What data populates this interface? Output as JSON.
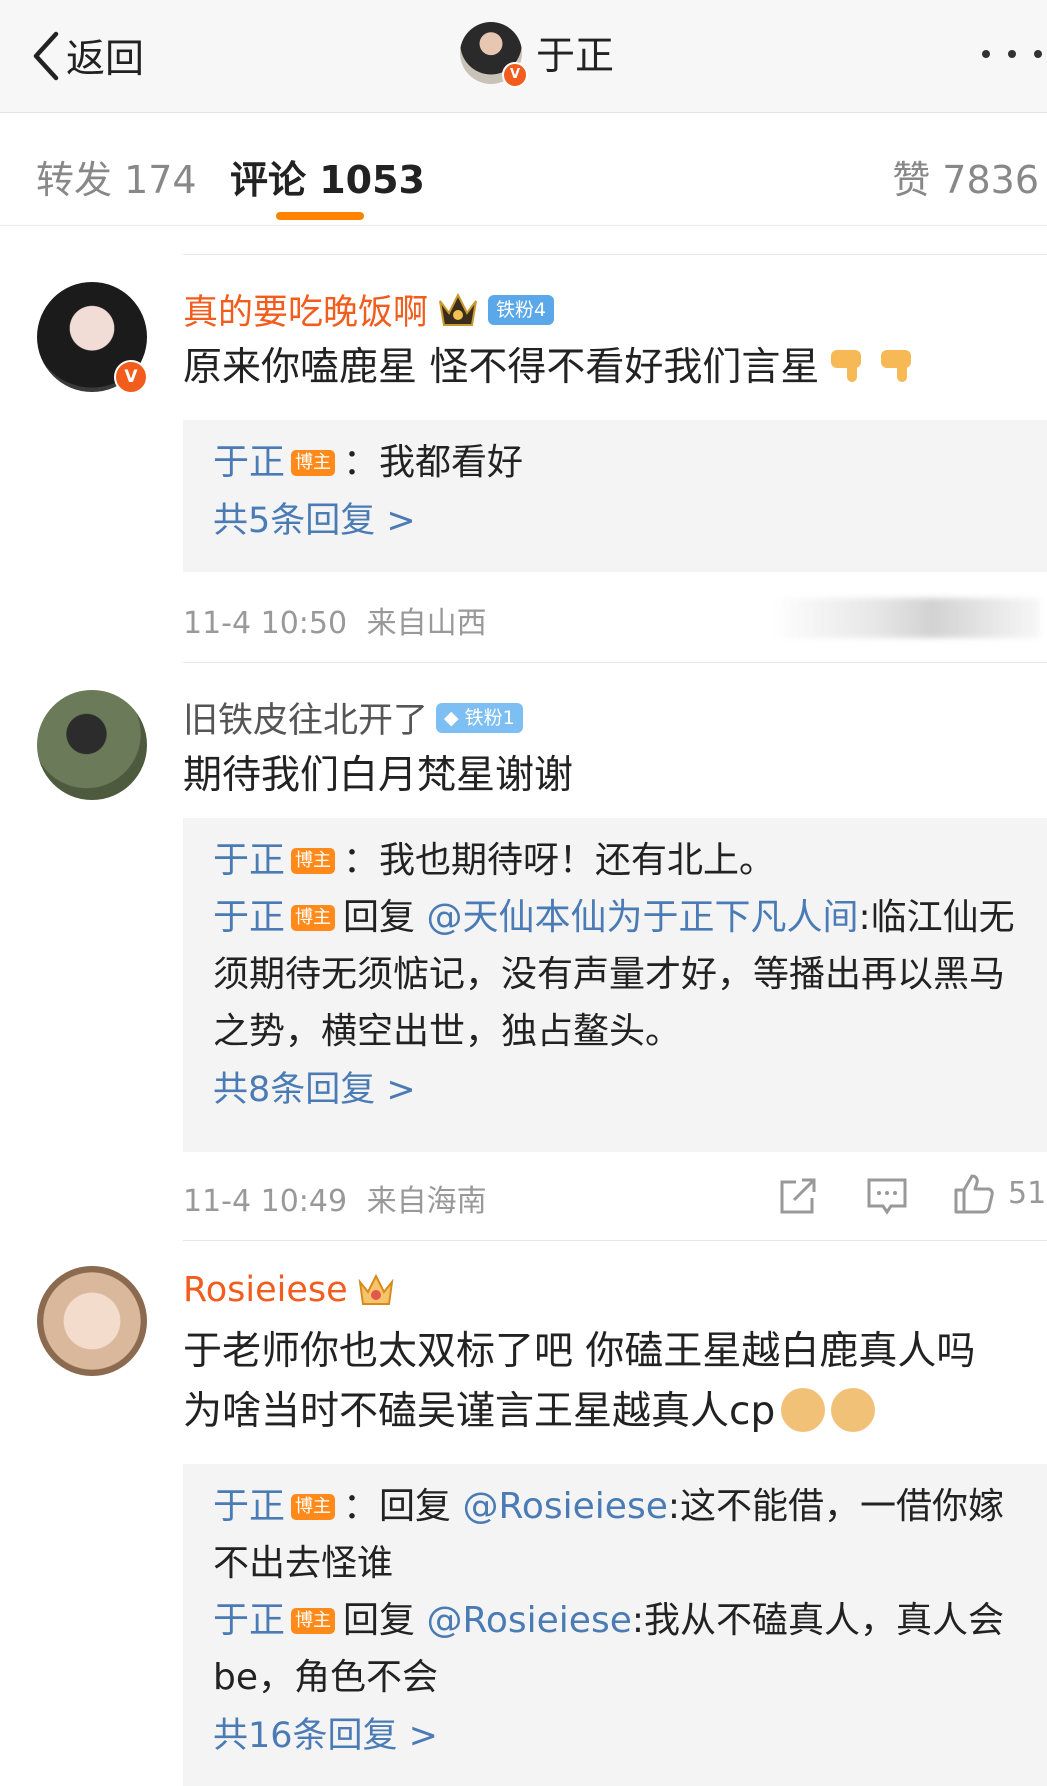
{
  "nav": {
    "back_label": "返回",
    "title": "于正"
  },
  "tabs": {
    "repost": "转发 174",
    "comments": "评论 1053",
    "likes": "赞 7836",
    "active_color": "#ff8200"
  },
  "colors": {
    "username_vip": "#f25c1c",
    "username_normal": "#555555",
    "reply_name": "#4a7bb5",
    "blogger_tag": "#ff8a1a"
  },
  "comments": [
    {
      "username": "真的要吃晚饭啊",
      "badge": "铁粉4",
      "text": "原来你嗑鹿星 怪不得不看好我们言星",
      "replies": [
        {
          "name": "于正",
          "tag": "博主",
          "text": "：我都看好"
        }
      ],
      "more_replies": "共5条回复 >",
      "time": "11-4 10:50",
      "location": "来自山西"
    },
    {
      "username": "旧铁皮往北开了",
      "badge": "铁粉1",
      "text": "期待我们白月梵星谢谢",
      "replies": [
        {
          "name": "于正",
          "tag": "博主",
          "text": "：我也期待呀！还有北上。"
        },
        {
          "name": "于正",
          "tag": "博主",
          "prefix": "回复 ",
          "mention": "@天仙本仙为于正下凡人间",
          "text": ":临江仙无须期待无须惦记，没有声量才好，等播出再以黑马之势，横空出世，独占鳌头。"
        }
      ],
      "more_replies": "共8条回复 >",
      "time": "11-4 10:49",
      "location": "来自海南",
      "like_count": "51"
    },
    {
      "username": "Rosieiese",
      "text": "于老师你也太双标了吧 你磕王星越白鹿真人吗 为啥当时不磕吴谨言王星越真人cp",
      "replies": [
        {
          "name": "于正",
          "tag": "博主",
          "prefix": "：回复 ",
          "mention": "@Rosieiese",
          "text": ":这不能借，一借你嫁不出去怪谁"
        },
        {
          "name": "于正",
          "tag": "博主",
          "prefix": "回复 ",
          "mention": "@Rosieiese",
          "text": ":我从不磕真人，真人会be，角色不会"
        }
      ],
      "more_replies": "共16条回复 >"
    }
  ]
}
